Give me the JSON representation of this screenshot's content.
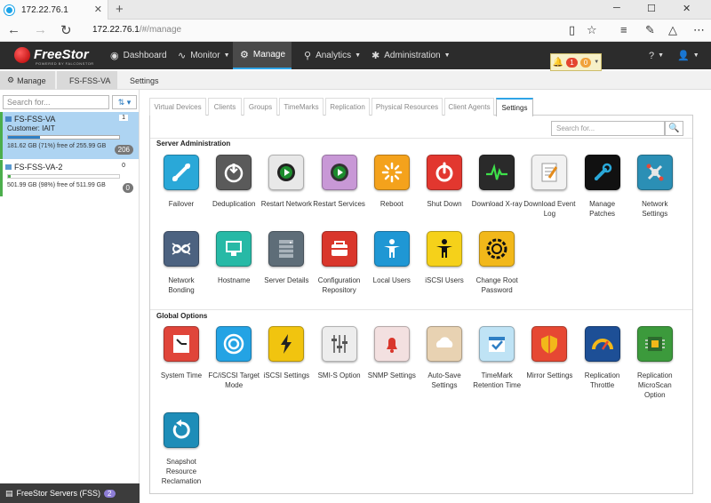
{
  "browser": {
    "tab_title": "172.22.76.1",
    "url_host": "172.22.76.1",
    "url_path": "/#/manage"
  },
  "app": {
    "logo": "FreeStor",
    "logo_sub": "POWERED BY FALCONSTOR",
    "nav": [
      {
        "label": "Dashboard"
      },
      {
        "label": "Monitor"
      },
      {
        "label": "Manage"
      },
      {
        "label": "Analytics"
      },
      {
        "label": "Administration"
      }
    ],
    "alerts": {
      "red": "1",
      "orange": "0"
    }
  },
  "breadcrumb": [
    "Manage",
    "FS-FSS-VA",
    "Settings"
  ],
  "left": {
    "search_placeholder": "Search for...",
    "servers": [
      {
        "name": "FS-FSS-VA",
        "customer": "Customer: IAIT",
        "usage": "181.62 GB (71%) free of 255.99 GB",
        "free_pct": 71,
        "count": "1",
        "pill": "206"
      },
      {
        "name": "FS-FSS-VA-2",
        "usage": "501.99 GB (98%) free of 511.99 GB",
        "free_pct": 2,
        "count": "0",
        "pill": "0"
      }
    ],
    "footer": "FreeStor Servers (FSS)",
    "footer_count": "2"
  },
  "tabs": [
    "Virtual Devices",
    "Clients",
    "Groups",
    "TimeMarks",
    "Replication",
    "Physical Resources",
    "Client Agents",
    "Settings"
  ],
  "search_placeholder": "Search for...",
  "sections": {
    "server_admin": "Server Administration",
    "global": "Global Options"
  },
  "server_admin": [
    {
      "label": "Failover",
      "icon": "failover-icon",
      "color": "#2aa8d8"
    },
    {
      "label": "Deduplication",
      "icon": "deduplication-icon",
      "color": "#5a5a5a"
    },
    {
      "label": "Restart Network",
      "icon": "restart-network-icon",
      "color": "#e8e8e8"
    },
    {
      "label": "Restart Services",
      "icon": "restart-services-icon",
      "color": "#c898d6"
    },
    {
      "label": "Reboot",
      "icon": "reboot-icon",
      "color": "#f4a21c"
    },
    {
      "label": "Shut Down",
      "icon": "shutdown-icon",
      "color": "#e2372f"
    },
    {
      "label": "Download X-ray",
      "icon": "xray-icon",
      "color": "#2a2a2a"
    },
    {
      "label": "Download Event Log",
      "icon": "event-log-icon",
      "color": "#f2f2f2"
    },
    {
      "label": "Manage Patches",
      "icon": "patches-icon",
      "color": "#111111"
    },
    {
      "label": "Network Settings",
      "icon": "network-settings-icon",
      "color": "#2b8fb5"
    },
    {
      "label": "Network Bonding",
      "icon": "network-bonding-icon",
      "color": "#4c6280"
    },
    {
      "label": "Hostname",
      "icon": "hostname-icon",
      "color": "#27b9a6"
    },
    {
      "label": "Server Details",
      "icon": "server-details-icon",
      "color": "#5e6d78"
    },
    {
      "label": "Configuration Repository",
      "icon": "config-repository-icon",
      "color": "#d9362b"
    },
    {
      "label": "Local Users",
      "icon": "local-users-icon",
      "color": "#1f97d4"
    },
    {
      "label": "iSCSI Users",
      "icon": "iscsi-users-icon",
      "color": "#f5d11a"
    },
    {
      "label": "Change Root Password",
      "icon": "root-password-icon",
      "color": "#f2b81a"
    }
  ],
  "global_options": [
    {
      "label": "System Time",
      "icon": "system-time-icon",
      "color": "#e0453a"
    },
    {
      "label": "FC/iSCSI Target Mode",
      "icon": "target-mode-icon",
      "color": "#24a3e4"
    },
    {
      "label": "iSCSI Settings",
      "icon": "iscsi-settings-icon",
      "color": "#f1c40f"
    },
    {
      "label": "SMI-S Option",
      "icon": "smis-option-icon",
      "color": "#ededed"
    },
    {
      "label": "SNMP Settings",
      "icon": "snmp-settings-icon",
      "color": "#f3e0e0"
    },
    {
      "label": "Auto-Save Settings",
      "icon": "auto-save-icon",
      "color": "#e8d2b2"
    },
    {
      "label": "TimeMark Retention Time",
      "icon": "timemark-retention-icon",
      "color": "#bfe3f5"
    },
    {
      "label": "Mirror Settings",
      "icon": "mirror-settings-icon",
      "color": "#e64833"
    },
    {
      "label": "Replication Throttle",
      "icon": "replication-throttle-icon",
      "color": "#1d4f96"
    },
    {
      "label": "Replication MicroScan Option",
      "icon": "microscan-icon",
      "color": "#3c9a3c"
    },
    {
      "label": "Snapshot Resource Reclamation",
      "icon": "snapshot-reclamation-icon",
      "color": "#1e8db8"
    }
  ]
}
